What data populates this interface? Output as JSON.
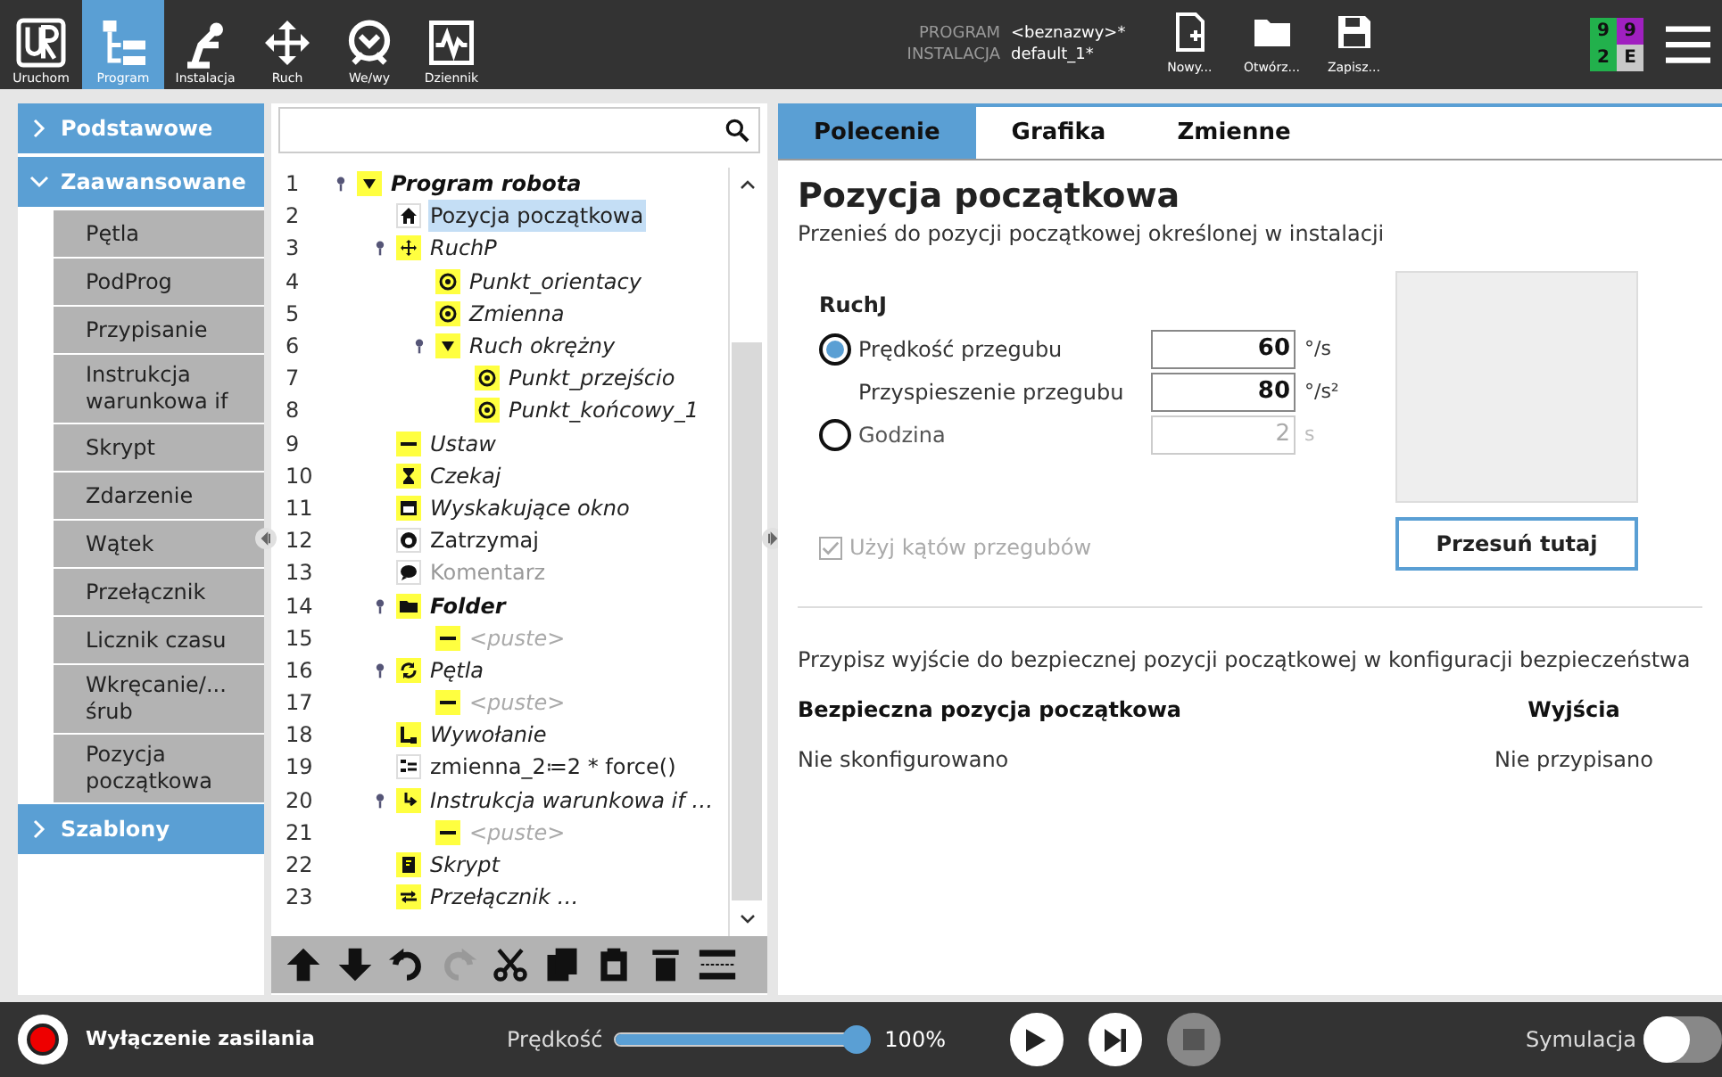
{
  "top_bar": {
    "nav": [
      {
        "label": "Uruchom",
        "kind": "logo",
        "selected": false
      },
      {
        "label": "Program",
        "kind": "program",
        "selected": true
      },
      {
        "label": "Instalacja",
        "kind": "robot",
        "selected": false
      },
      {
        "label": "Ruch",
        "kind": "move",
        "selected": false
      },
      {
        "label": "We/wy",
        "kind": "io",
        "selected": false
      },
      {
        "label": "Dziennik",
        "kind": "log",
        "selected": false
      }
    ],
    "program_label": "PROGRAM",
    "program_value": "<beznazwy>*",
    "installation_label": "INSTALACJA",
    "installation_value": "default_1*",
    "file_buttons": [
      {
        "label": "Nowy...",
        "kind": "new"
      },
      {
        "label": "Otwórz...",
        "kind": "open"
      },
      {
        "label": "Zapisz...",
        "kind": "save"
      }
    ],
    "badges": [
      {
        "text": "9",
        "color": "#22b14c"
      },
      {
        "text": "9",
        "color": "#a020c0"
      },
      {
        "text": "2",
        "color": "#22b14c"
      },
      {
        "text": "E",
        "color": "#c8c8c8"
      }
    ]
  },
  "sidebar": {
    "sections": [
      {
        "label": "Podstawowe",
        "expanded": false
      },
      {
        "label": "Zaawansowane",
        "expanded": true,
        "items": [
          "Pętla",
          "PodProg",
          "Przypisanie",
          "Instrukcja warunkowa if",
          "Skrypt",
          "Zdarzenie",
          "Wątek",
          "Przełącznik",
          "Licznik czasu",
          "Wkręcanie/... śrub",
          "Pozycja początkowa"
        ]
      },
      {
        "label": "Szablony",
        "expanded": false
      }
    ]
  },
  "tree": {
    "nodes": [
      {
        "num": "1",
        "label": "Program robota",
        "kind": "program",
        "selected": false,
        "expanded": true,
        "children": [
          {
            "num": "2",
            "label": "Pozycja początkowa",
            "kind": "home",
            "selected": true
          },
          {
            "num": "3",
            "label": "RuchP",
            "kind": "move",
            "selected": false,
            "expanded": true,
            "children": [
              {
                "num": "4",
                "label": "Punkt_orientacy",
                "kind": "waypoint",
                "selected": false
              },
              {
                "num": "5",
                "label": "Zmienna",
                "kind": "waypoint",
                "selected": false
              },
              {
                "num": "6",
                "label": "Ruch okrężny",
                "kind": "circular",
                "selected": false,
                "expanded": true,
                "children": [
                  {
                    "num": "7",
                    "label": "Punkt_przejścio",
                    "kind": "waypoint",
                    "selected": false
                  },
                  {
                    "num": "8",
                    "label": "Punkt_końcowy_1",
                    "kind": "waypoint",
                    "selected": false
                  }
                ]
              }
            ]
          },
          {
            "num": "9",
            "label": "Ustaw",
            "kind": "set",
            "selected": false
          },
          {
            "num": "10",
            "label": "Czekaj",
            "kind": "wait",
            "selected": false
          },
          {
            "num": "11",
            "label": "Wyskakujące okno",
            "kind": "popup",
            "selected": false
          },
          {
            "num": "12",
            "label": "Zatrzymaj",
            "kind": "halt",
            "selected": false
          },
          {
            "num": "13",
            "label": "Komentarz",
            "kind": "comment",
            "selected": false
          },
          {
            "num": "14",
            "label": "Folder",
            "kind": "folder",
            "selected": false,
            "expanded": true,
            "children": [
              {
                "num": "15",
                "label": "<puste>",
                "kind": "empty",
                "selected": false
              }
            ]
          },
          {
            "num": "16",
            "label": "Pętla",
            "kind": "loop",
            "selected": false,
            "expanded": true,
            "children": [
              {
                "num": "17",
                "label": "<puste>",
                "kind": "empty",
                "selected": false
              }
            ]
          },
          {
            "num": "18",
            "label": "Wywołanie",
            "kind": "call",
            "selected": false
          },
          {
            "num": "19",
            "label": "zmienna_2≔2 * force()",
            "kind": "assignment",
            "selected": false
          },
          {
            "num": "20",
            "label": "Instrukcja warunkowa if …",
            "kind": "if",
            "selected": false,
            "expanded": true,
            "children": [
              {
                "num": "21",
                "label": "<puste>",
                "kind": "empty",
                "selected": false
              }
            ]
          },
          {
            "num": "22",
            "label": "Skrypt",
            "kind": "script",
            "selected": false
          },
          {
            "num": "23",
            "label": "Przełącznik …",
            "kind": "switch",
            "selected": false
          }
        ]
      }
    ],
    "toolbar": [
      {
        "kind": "up",
        "disabled": false
      },
      {
        "kind": "down",
        "disabled": false
      },
      {
        "kind": "undo",
        "disabled": false
      },
      {
        "kind": "redo",
        "disabled": true
      },
      {
        "kind": "cut",
        "disabled": false
      },
      {
        "kind": "copy",
        "disabled": false
      },
      {
        "kind": "paste",
        "disabled": false
      },
      {
        "kind": "delete",
        "disabled": false
      },
      {
        "kind": "suppress",
        "disabled": false
      }
    ]
  },
  "panel": {
    "tabs": [
      {
        "label": "Polecenie",
        "selected": true
      },
      {
        "label": "Grafika",
        "selected": false
      },
      {
        "label": "Zmienne",
        "selected": false
      }
    ],
    "title": "Pozycja początkowa",
    "subtitle": "Przenieś do pozycji początkowej określonej w instalacji",
    "group_label": "RuchJ",
    "rows": [
      {
        "kind": "radio",
        "label": "Prędkość przegubu",
        "selected": true,
        "value": "60",
        "unit": "°/s",
        "disabled": false
      },
      {
        "kind": "field",
        "label": "Przyspieszenie przegubu",
        "value": "80",
        "unit": "°/s²",
        "disabled": false
      },
      {
        "kind": "radio",
        "label": "Godzina",
        "selected": false,
        "value": "2",
        "unit": "s",
        "disabled": true
      }
    ],
    "checkbox": {
      "label": "Użyj kątów przegubów",
      "checked": true,
      "disabled": true
    },
    "move_button": "Przesuń tutaj",
    "safety": {
      "description": "Przypisz wyjście do bezpiecznej pozycji początkowej w konfiguracji bezpieczeństwa",
      "columns": [
        "Bezpieczna pozycja początkowa",
        "Wyjścia"
      ],
      "values": [
        "Nie skonfigurowano",
        "Nie przypisano"
      ]
    }
  },
  "bottom_bar": {
    "power_label": "Wyłączenie zasilania",
    "speed_label": "Prędkość",
    "speed": {
      "level": 1,
      "reading": "100%"
    },
    "controls": [
      {
        "kind": "play",
        "disabled": false
      },
      {
        "kind": "step",
        "disabled": false
      },
      {
        "kind": "stop",
        "disabled": true
      }
    ],
    "simulation": {
      "label": "Symulacja",
      "on": false
    }
  }
}
